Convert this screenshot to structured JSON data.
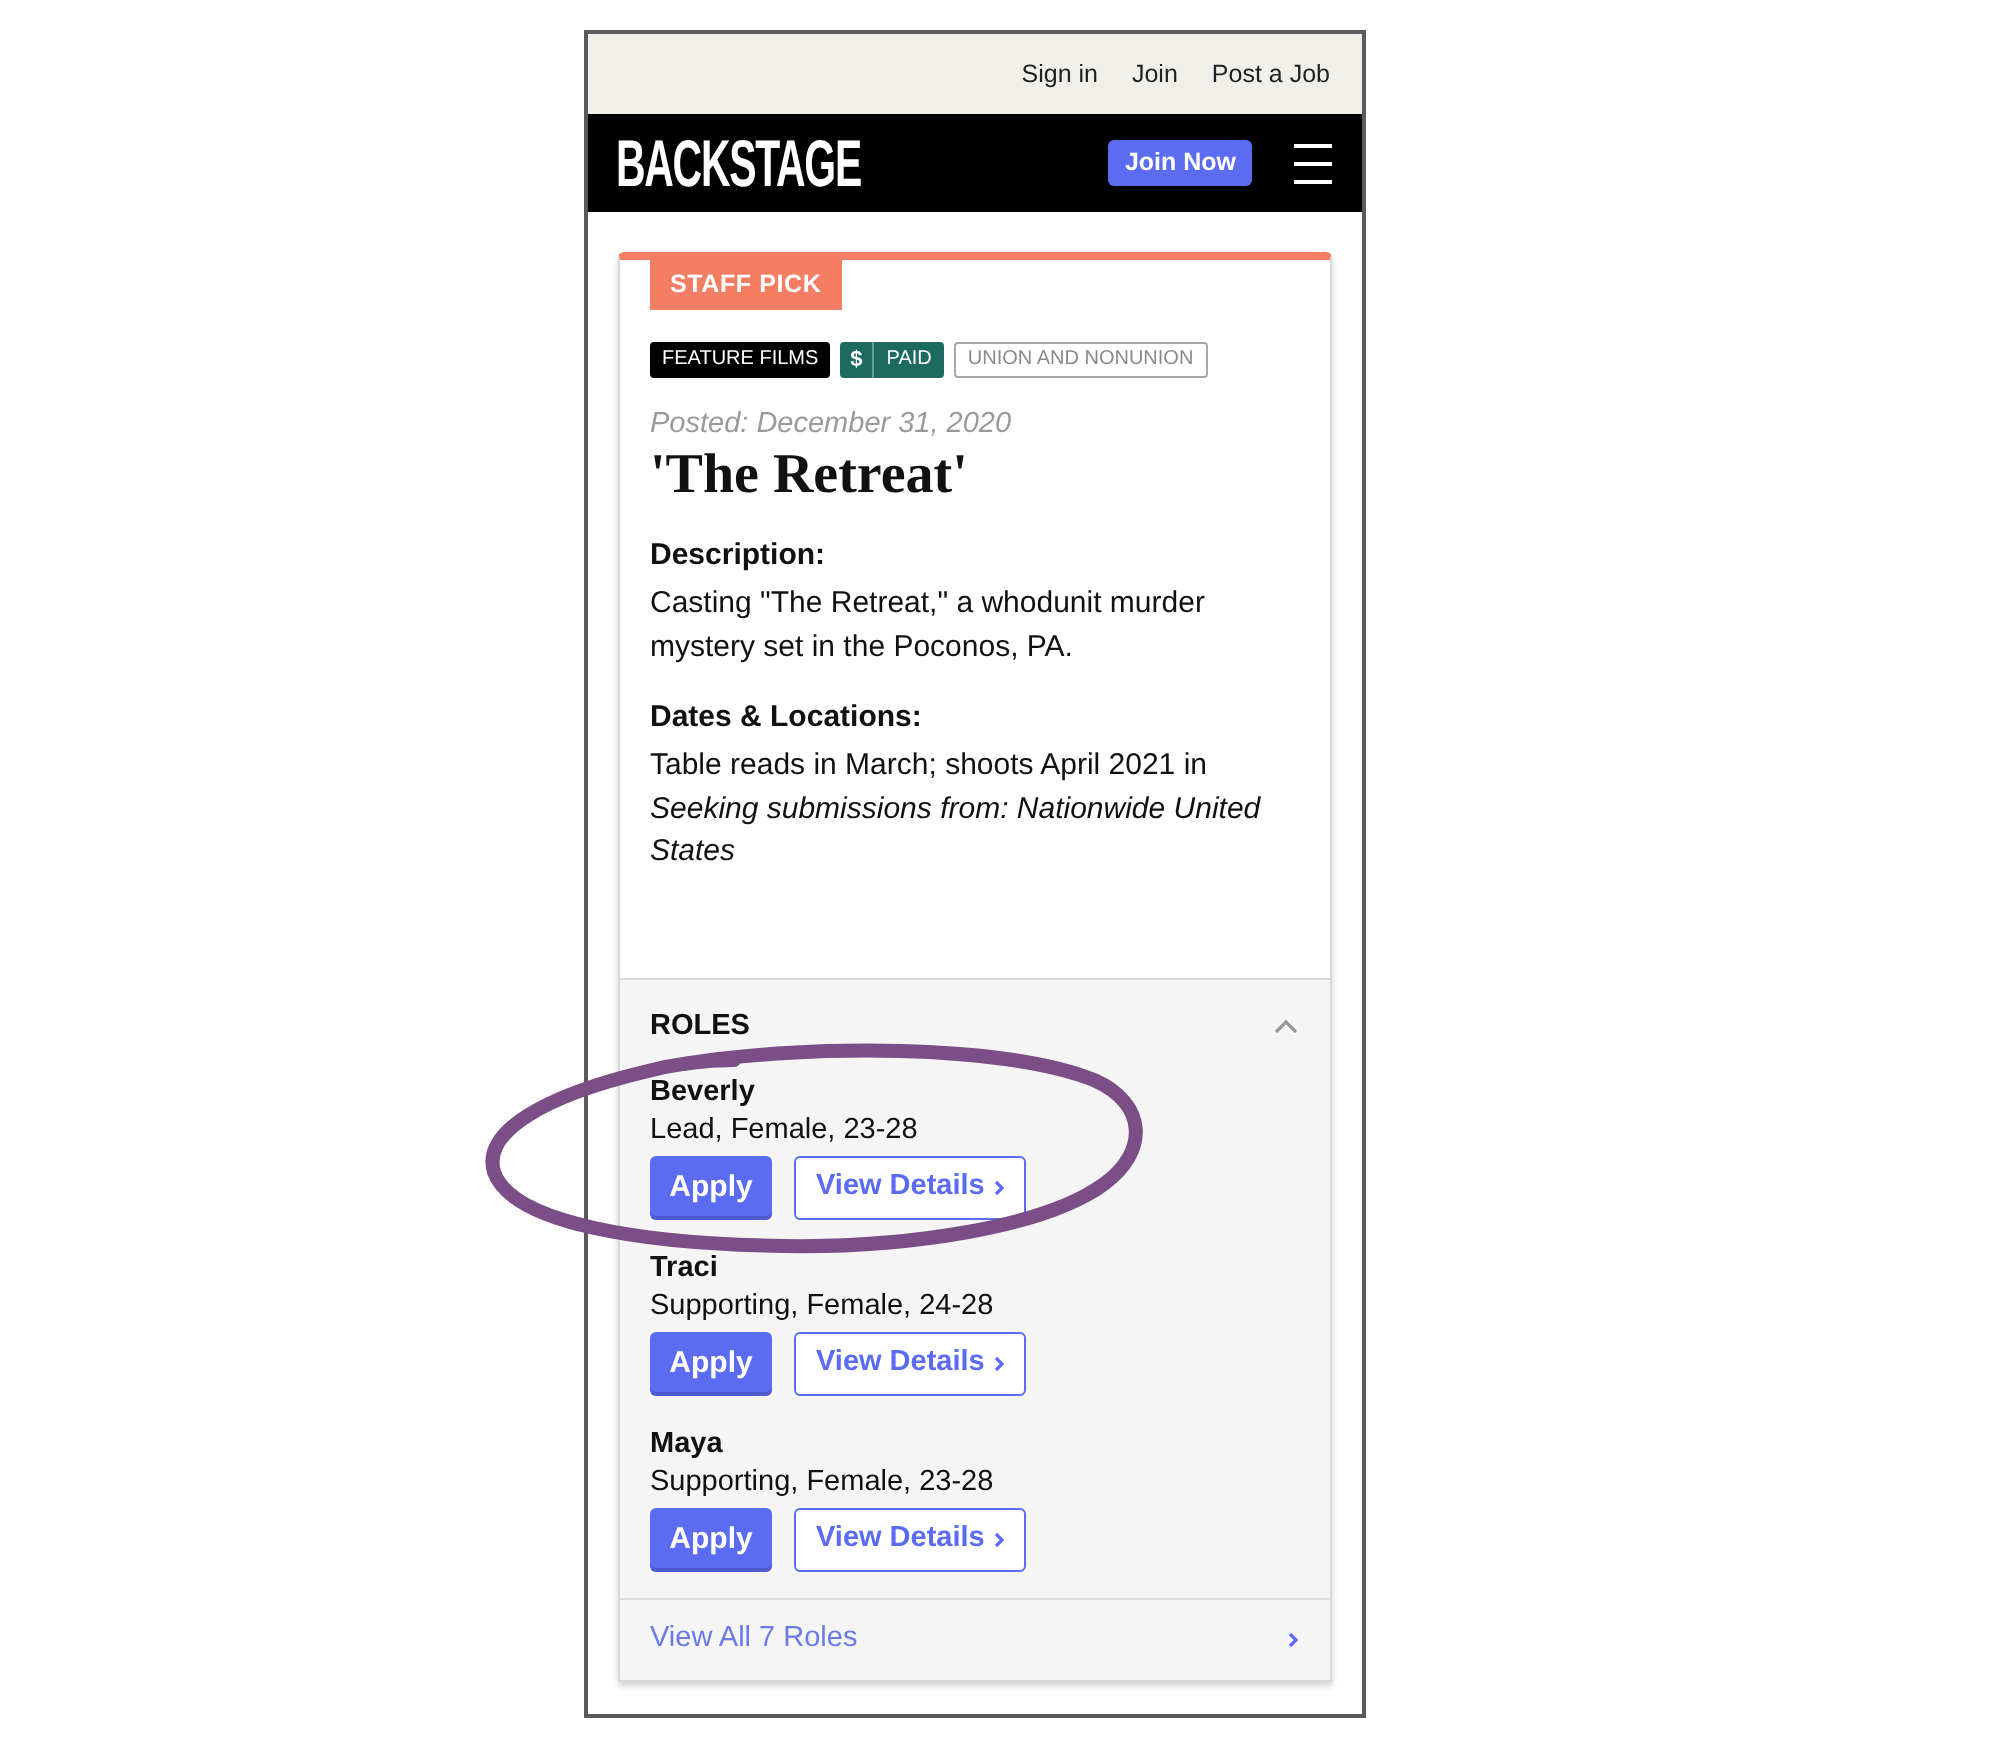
{
  "top_links": [
    "Sign in",
    "Join",
    "Post a Job"
  ],
  "header": {
    "logo": "BACKSTAGE",
    "cta": "Join Now"
  },
  "listing": {
    "badge": "STAFF PICK",
    "tags": [
      {
        "kind": "category",
        "label": "FEATURE FILMS"
      },
      {
        "kind": "paid",
        "symbol": "$",
        "label": "PAID"
      },
      {
        "kind": "outline",
        "label": "UNION AND NONUNION"
      }
    ],
    "posted": "Posted: December 31, 2020",
    "title": "'The Retreat'",
    "sections": [
      {
        "heading": "Description:",
        "lines": [
          {
            "kind": "plain",
            "text": "Casting \"The Retreat,\" a whodunit murder mystery set in the Poconos, PA."
          }
        ]
      },
      {
        "heading": "Dates & Locations:",
        "lines": [
          {
            "kind": "plain",
            "text": "Table reads in March; shoots April 2021 in"
          },
          {
            "kind": "italic",
            "text": "Seeking submissions from: Nationwide United States"
          }
        ]
      }
    ]
  },
  "roles": {
    "heading": "ROLES",
    "expanded": true,
    "items": [
      {
        "name": "Beverly",
        "details": "Lead, Female, 23-28",
        "apply": "Apply",
        "view": "View Details",
        "circled": true
      },
      {
        "name": "Traci",
        "details": "Supporting, Female, 24-28",
        "apply": "Apply",
        "view": "View Details",
        "circled": false
      },
      {
        "name": "Maya",
        "details": "Supporting, Female, 23-28",
        "apply": "Apply",
        "view": "View Details",
        "circled": false
      }
    ],
    "view_all": "View All 7 Roles"
  }
}
